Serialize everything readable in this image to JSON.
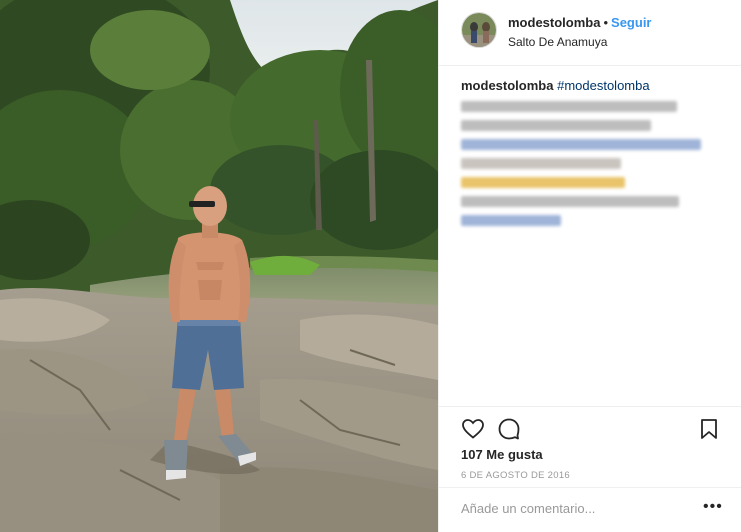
{
  "post": {
    "username": "modestolomba",
    "separator": "•",
    "follow_label": "Seguir",
    "location": "Salto De Anamuya"
  },
  "caption": {
    "username": "modestolomba",
    "hashtag": "#modestolomba",
    "redacted_lines": [
      {
        "color": "#bdbdbd",
        "width": 216
      },
      {
        "color": "#bdbdbd",
        "width": 190
      },
      {
        "color": "#9fb4d8",
        "width": 240
      },
      {
        "color": "#c9c4be",
        "width": 160
      },
      {
        "color": "#e9c46a",
        "width": 164
      },
      {
        "color": "#bdbdbd",
        "width": 218
      },
      {
        "color": "#9fb4d8",
        "width": 100
      }
    ]
  },
  "actions": {
    "like_icon": "heart-outline-icon",
    "comment_icon": "speech-bubble-icon",
    "save_icon": "bookmark-icon"
  },
  "likes_text": "107 Me gusta",
  "date_text": "6 DE AGOSTO DE 2016",
  "comment": {
    "placeholder": "Añade un comentario...",
    "more_label": "•••"
  },
  "colors": {
    "follow": "#3897f0",
    "hashtag": "#003569",
    "muted": "#999999",
    "divider": "#efefef"
  }
}
